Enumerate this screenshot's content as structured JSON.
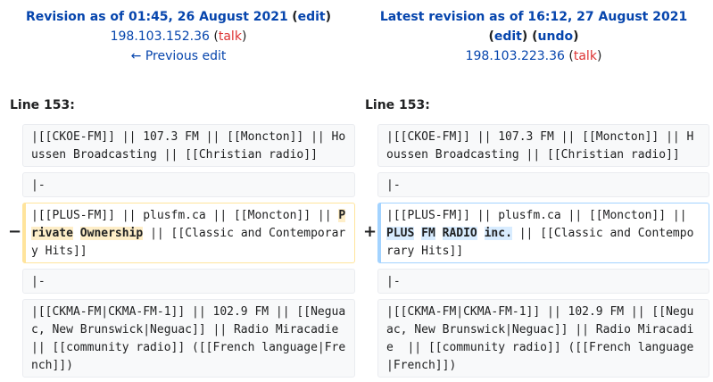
{
  "left_header": {
    "title": "Revision as of 01:45, 26 August 2021",
    "edit": "edit",
    "user": "198.103.152.36",
    "talk": "talk",
    "prev": "← Previous edit"
  },
  "right_header": {
    "title": "Latest revision as of 16:12, 27 August 2021",
    "edit": "edit",
    "undo": "undo",
    "user": "198.103.223.36",
    "talk": "talk"
  },
  "line_label": "Line 153:",
  "rows": {
    "r1": "|[[CKOE-FM]] || 107.3 FM || [[Moncton]] || Houssen Broadcasting || [[Christian radio]]",
    "r2": "|-",
    "r3_prefix": "|[[PLUS-FM]] || plusfm.ca || [[Moncton]] || ",
    "r3_suffix": " || [[Classic and Contemporary Hits]]",
    "r3_del_words": [
      "Private",
      "Ownership"
    ],
    "r3_add_words": [
      "PLUS",
      "FM",
      "RADIO",
      "inc."
    ],
    "r4": "|-",
    "r5": "|[[CKMA-FM|CKMA-FM-1]] || 102.9 FM || [[Neguac, New Brunswick|Neguac]] || Radio Miracadie  || [[community radio]] ([[French language|French]])"
  },
  "markers": {
    "minus": "−",
    "plus": "+"
  }
}
